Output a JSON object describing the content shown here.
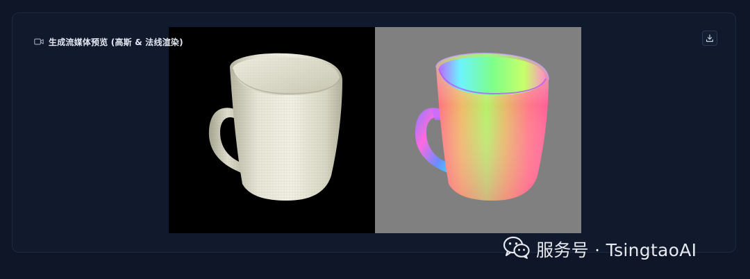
{
  "panel": {
    "title": "生成流媒体预览 (高斯 & 法线渲染)",
    "header_icon": "video-camera-icon",
    "download_icon": "download-icon"
  },
  "preview": {
    "left_render": {
      "mode": "gaussian",
      "background": "#000000",
      "object": "mug"
    },
    "right_render": {
      "mode": "normal",
      "background": "#808080",
      "object": "mug"
    }
  },
  "watermark": {
    "icon": "wechat-icon",
    "text": "服务号 · TsingtaoAI"
  },
  "colors": {
    "page_background": "#0f1627",
    "panel_background": "#111a2d",
    "panel_border": "#1f2a40",
    "title_text": "#e3e8f2",
    "watermark_text": "#e7e9ee"
  }
}
